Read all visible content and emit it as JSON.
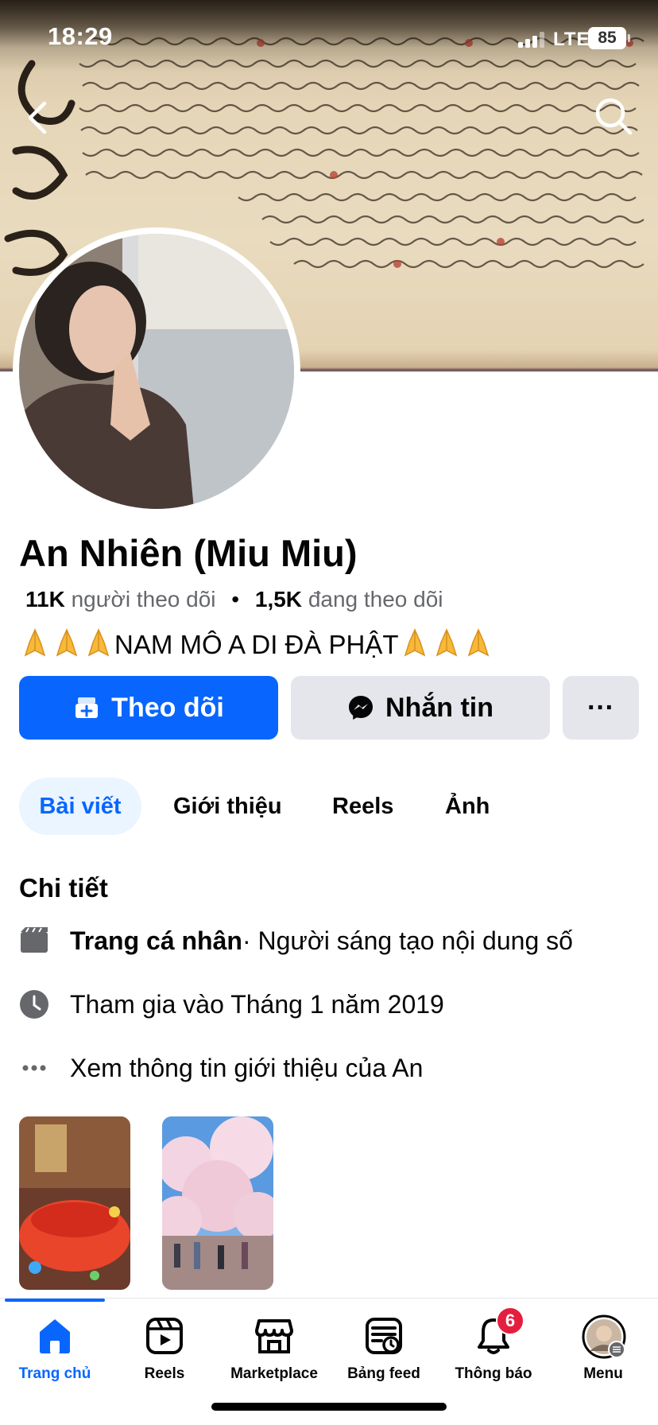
{
  "status_bar": {
    "time": "18:29",
    "network": "LTE",
    "battery": "85"
  },
  "profile": {
    "name": "An Nhiên (Miu Miu)",
    "followers_count": "11K",
    "followers_label": "người theo dõi",
    "separator": "•",
    "following_count": "1,5K",
    "following_label": "đang theo dõi",
    "bio_text": "NAM MÔ A DI ĐÀ PHẬT"
  },
  "actions": {
    "follow_label": "Theo dõi",
    "message_label": "Nhắn tin",
    "more_label": "···"
  },
  "tabs": [
    {
      "label": "Bài viết",
      "active": true
    },
    {
      "label": "Giới thiệu"
    },
    {
      "label": "Reels"
    },
    {
      "label": "Ảnh"
    }
  ],
  "details": {
    "title": "Chi tiết",
    "page_type_bold": "Trang cá nhân",
    "page_type_rest": " · Người sáng tạo nội dung số",
    "joined": "Tham gia vào Tháng 1 năm 2019",
    "see_about": "Xem thông tin giới thiệu của An"
  },
  "bottom_nav": [
    {
      "label": "Trang chủ",
      "icon": "home-icon",
      "active": true
    },
    {
      "label": "Reels",
      "icon": "reels-icon"
    },
    {
      "label": "Marketplace",
      "icon": "marketplace-icon"
    },
    {
      "label": "Bảng feed",
      "icon": "feed-icon"
    },
    {
      "label": "Thông báo",
      "icon": "bell-icon",
      "badge": "6"
    },
    {
      "label": "Menu",
      "icon": "menu-avatar"
    }
  ],
  "colors": {
    "accent": "#0866ff",
    "badge": "#e41e3f",
    "button_gray": "#e4e6eb",
    "secondary_text": "#65676b"
  }
}
